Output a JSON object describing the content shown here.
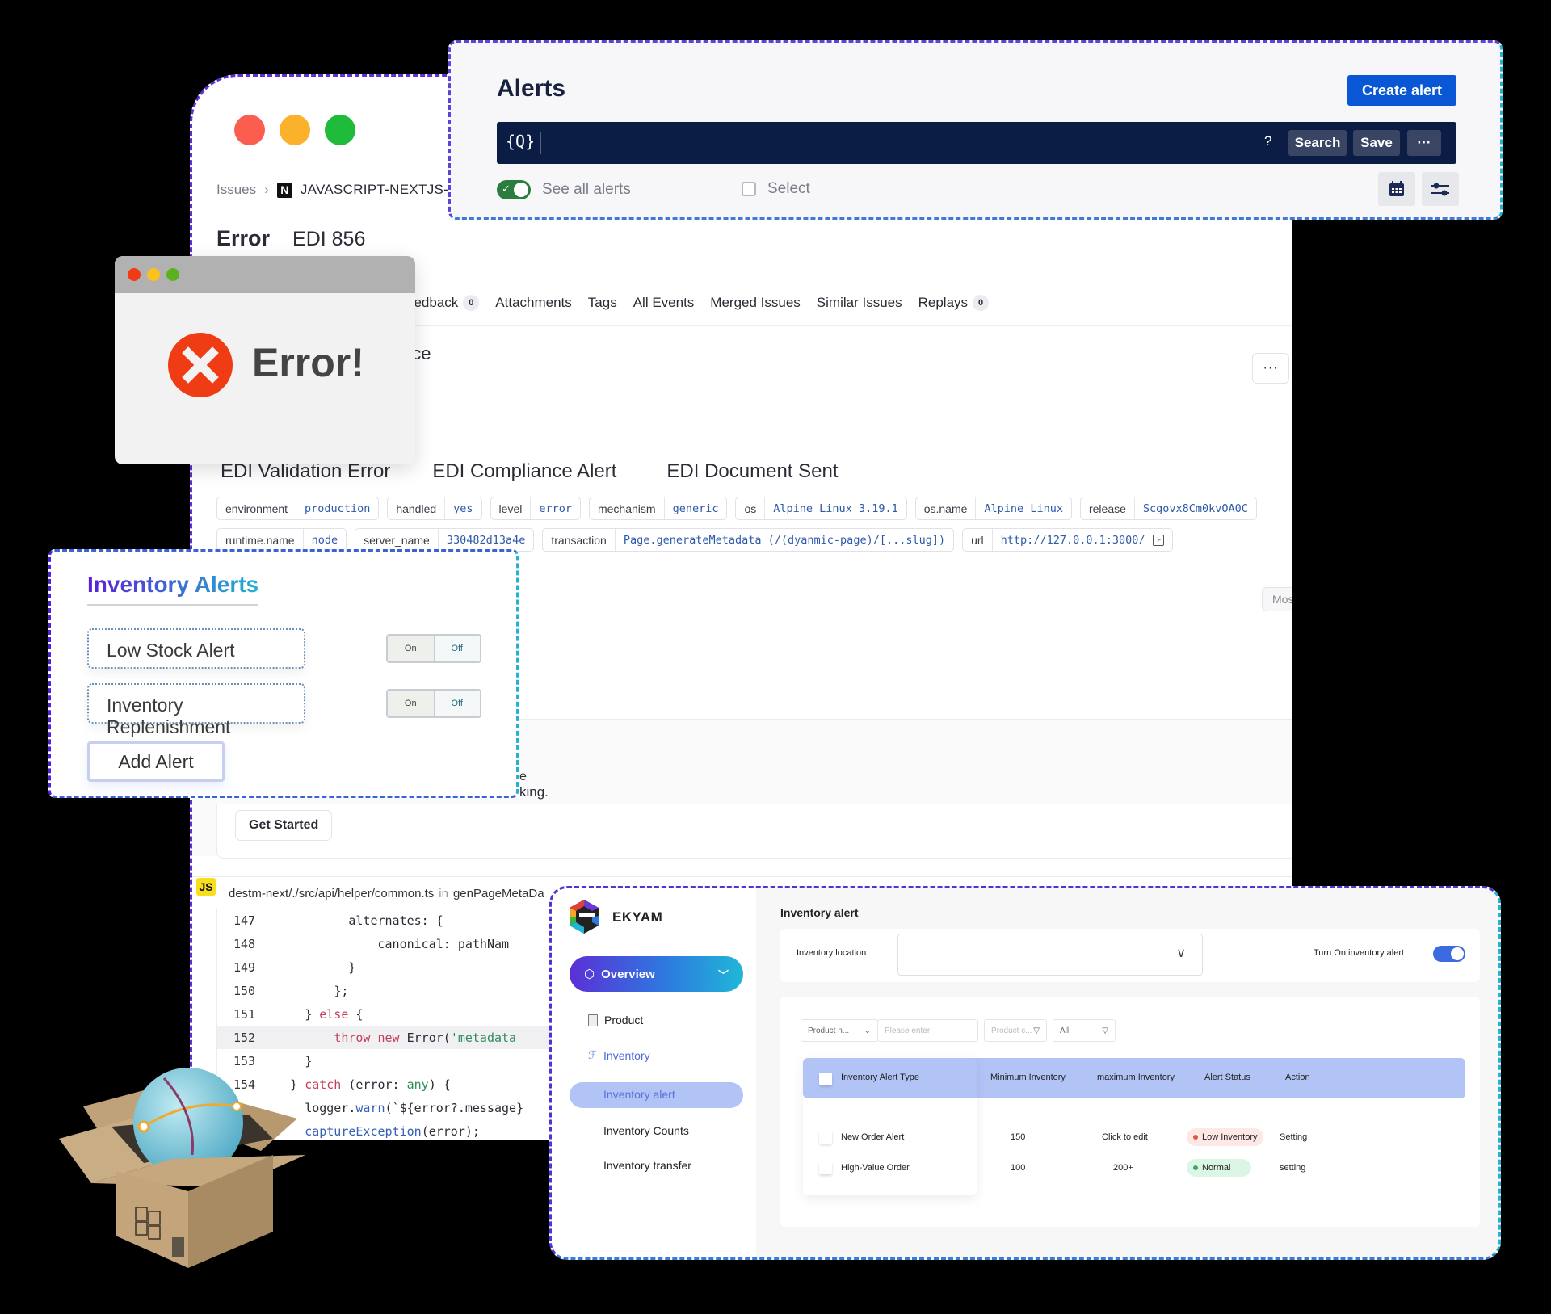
{
  "error_window": {
    "breadcrumb": {
      "root": "Issues",
      "project_logo": "N",
      "project": "JAVASCRIPT-NEXTJS-C"
    },
    "title_label": "Error",
    "title_value": "EDI 856",
    "tabs": [
      {
        "label": "eedback",
        "count": "0"
      },
      {
        "label": "Attachments"
      },
      {
        "label": "Tags"
      },
      {
        "label": "All Events"
      },
      {
        "label": "Merged Issues"
      },
      {
        "label": "Similar Issues"
      },
      {
        "label": "Replays",
        "count": "0"
      }
    ],
    "section_heading_partial": "nce",
    "more_label": "···",
    "events": [
      "EDI Validation Error",
      "EDI Compliance Alert",
      "EDI Document Sent"
    ],
    "tags_row1": [
      {
        "key": "environment",
        "value": "production"
      },
      {
        "key": "handled",
        "value": "yes"
      },
      {
        "key": "level",
        "value": "error"
      },
      {
        "key": "mechanism",
        "value": "generic"
      },
      {
        "key": "os",
        "value": "Alpine Linux 3.19.1"
      },
      {
        "key": "os.name",
        "value": "Alpine Linux"
      },
      {
        "key": "release",
        "value": "Scgovx8Cm0kvOA0C"
      }
    ],
    "tags_row2": [
      {
        "key": "runtime.name",
        "value": "node"
      },
      {
        "key": "server_name",
        "value": "330482d13a4e"
      },
      {
        "key": "transaction",
        "value": "Page.generateMetadata (/(dyanmic-page)/[...slug])"
      },
      {
        "key": "url",
        "value": "http://127.0.0.1:3000/"
      }
    ],
    "mos_button": "Mos",
    "panel_text_partial_1": "e",
    "panel_text_partial_2": "king.",
    "get_started": "Get Started",
    "file": {
      "badge": "JS",
      "path": "destm-next/./src/api/helper/common.ts",
      "in": "in",
      "func": "genPageMetaDa"
    },
    "code_lines": [
      {
        "num": "147",
        "indent": "            ",
        "parts": [
          {
            "t": "alternates: {",
            "c": ""
          }
        ]
      },
      {
        "num": "148",
        "indent": "                ",
        "parts": [
          {
            "t": "canonical: pathNam",
            "c": ""
          }
        ]
      },
      {
        "num": "149",
        "indent": "            ",
        "parts": [
          {
            "t": "}",
            "c": ""
          }
        ]
      },
      {
        "num": "150",
        "indent": "          ",
        "parts": [
          {
            "t": "};",
            "c": ""
          }
        ]
      },
      {
        "num": "151",
        "indent": "      ",
        "parts": [
          {
            "t": "} ",
            "c": ""
          },
          {
            "t": "else",
            "c": "kw"
          },
          {
            "t": " {",
            "c": ""
          }
        ]
      },
      {
        "num": "152",
        "indent": "          ",
        "parts": [
          {
            "t": "throw new",
            "c": "kw"
          },
          {
            "t": " Error(",
            "c": ""
          },
          {
            "t": "'metadata",
            "c": "str"
          }
        ],
        "highlight": true
      },
      {
        "num": "153",
        "indent": "      ",
        "parts": [
          {
            "t": "}",
            "c": ""
          }
        ]
      },
      {
        "num": "154",
        "indent": "    ",
        "parts": [
          {
            "t": "} ",
            "c": ""
          },
          {
            "t": "catch",
            "c": "kw"
          },
          {
            "t": " (error: ",
            "c": ""
          },
          {
            "t": "any",
            "c": "ty"
          },
          {
            "t": ") {",
            "c": ""
          }
        ]
      },
      {
        "num": "",
        "indent": "      ",
        "parts": [
          {
            "t": "logger.",
            "c": ""
          },
          {
            "t": "warn",
            "c": "fn"
          },
          {
            "t": "(`${error?.message}",
            "c": ""
          }
        ]
      },
      {
        "num": "",
        "indent": "      ",
        "parts": [
          {
            "t": "captureException",
            "c": "fn"
          },
          {
            "t": "(error);",
            "c": ""
          }
        ]
      }
    ]
  },
  "alerts_panel": {
    "title": "Alerts",
    "create_button": "Create alert",
    "query_icon": "{Q}",
    "help": "?",
    "search_button": "Search",
    "save_button": "Save",
    "more_button": "···",
    "see_all_label": "See all alerts",
    "see_all_enabled": true,
    "select_label": "Select",
    "icons": [
      "calendar-icon",
      "sliders-icon"
    ]
  },
  "error_dialog": {
    "text": "Error!"
  },
  "inventory_alerts_card": {
    "title": "Inventory Alerts",
    "alerts": [
      {
        "name": "Low Stock Alert",
        "on": "On",
        "off": "Off"
      },
      {
        "name": "Inventory Replenishment",
        "on": "On",
        "off": "Off"
      }
    ],
    "add_button": "Add Alert"
  },
  "ekyam": {
    "brand": "EKYAM",
    "nav": {
      "overview": "Overview",
      "product": "Product",
      "inventory": "Inventory",
      "inventory_alert": "Inventory alert",
      "inventory_counts": "Inventory Counts",
      "inventory_transfer": "Inventory transfer"
    },
    "page_title": "Inventory alert",
    "location_label": "Inventory  location",
    "location_value": "",
    "toggle_label": "Turn On inventory alert",
    "toggle_on": true,
    "filters": {
      "product_field": "Product n...",
      "search_placeholder": "Please enter",
      "product_code": "Product c...",
      "status": "All"
    },
    "table": {
      "headers": [
        "Inventory  Alert Type",
        "Minimum Inventory",
        "maximum Inventory",
        "Alert Status",
        "Action"
      ],
      "rows": [
        {
          "type": "New Order Alert",
          "min": "150",
          "max": "Click to edit",
          "status": "Low Inventory",
          "status_kind": "low",
          "action": "Setting"
        },
        {
          "type": "High-Value Order",
          "min": "100",
          "max": "200+",
          "status": "Normal",
          "status_kind": "normal",
          "action": "setting"
        }
      ]
    }
  },
  "colors": {
    "primary_blue": "#0a57d6",
    "query_bar": "#0b1d44",
    "error_red": "#f03c14",
    "gradient_start": "#5b2fd6",
    "gradient_end": "#1fb7d8"
  }
}
